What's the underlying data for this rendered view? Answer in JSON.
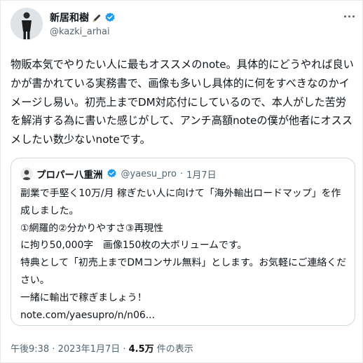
{
  "tweet": {
    "author_name": "新居和樹",
    "author_handle": "@kazki_arhai",
    "body": "物販本気でやりたい人に最もオススメのnote。具体的にどうやれば良いかが書かれている実務書で、画像も多いし具体的に何をすべきなのかイメージし易い。初売上までDM対応付にしているので、本人がした苦労を解消する為に書いた感じがして、アンチ高額noteの僕が他者にオススメしたい数少ないnoteです。",
    "timestamp": "午後9:38 · 2023年1月7日",
    "view_sep": " · ",
    "views_count": "4.5万",
    "views_label": " 件の表示"
  },
  "quote": {
    "author_name": "プロパー八重洲",
    "author_handle": "@yaesu_pro",
    "dot": "·",
    "date": "1月7日",
    "text": "副業で手堅く10万/月 稼ぎたい人に向けて「海外輸出ロードマップ」を作成しました。\n①網羅的②分かりやすさ③再現性\nに拘り50,000字　画像150枚の大ボリュームです。\n特典として「初売上までDMコンサル無料」とします。お気軽にご連絡ください。\n一緒に輸出で稼ぎましょう！\nnote.com/yaesupro/n/n06..."
  },
  "icons": {
    "verified": "verified-badge-icon",
    "pen": "pen-icon",
    "more": "more-options-icon"
  },
  "colors": {
    "verified": "#1d9bf0",
    "text": "#0f1419",
    "secondary": "#536471",
    "border": "#cfd9de"
  }
}
